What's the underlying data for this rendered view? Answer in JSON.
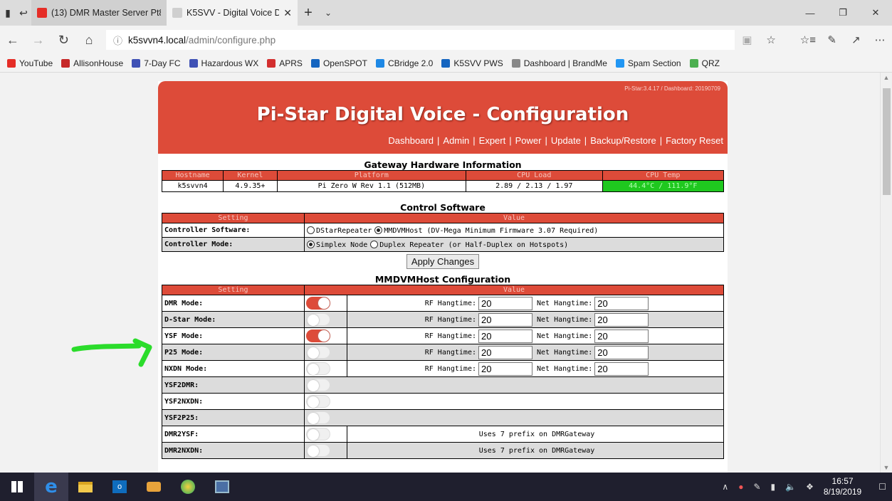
{
  "browser": {
    "tabs": [
      {
        "title": "(13) DMR Master Server Pt8",
        "active": false,
        "favicon_color": "#e52d27"
      },
      {
        "title": "K5SVV - Digital Voice D",
        "active": true,
        "favicon_color": "#cfcfcf"
      }
    ],
    "url": {
      "host": "k5svvn4.local",
      "path": "/admin/configure.php"
    },
    "favorites": [
      {
        "label": "YouTube",
        "color": "#e52d27"
      },
      {
        "label": "AllisonHouse",
        "color": "#c62828"
      },
      {
        "label": "7-Day FC",
        "color": "#3f51b5"
      },
      {
        "label": "Hazardous WX",
        "color": "#3f51b5"
      },
      {
        "label": "APRS",
        "color": "#d32f2f"
      },
      {
        "label": "OpenSPOT",
        "color": "#1565c0"
      },
      {
        "label": "CBridge 2.0",
        "color": "#1e88e5"
      },
      {
        "label": "K5SVV PWS",
        "color": "#1565c0"
      },
      {
        "label": "Dashboard | BrandMe",
        "color": "#888888"
      },
      {
        "label": "Spam Section",
        "color": "#2196f3"
      },
      {
        "label": "QRZ",
        "color": "#4caf50"
      }
    ]
  },
  "header": {
    "version": "Pi-Star:3.4.17 / Dashboard: 20190709",
    "title": "Pi-Star Digital Voice - Configuration",
    "nav": [
      "Dashboard",
      "Admin",
      "Expert",
      "Power",
      "Update",
      "Backup/Restore",
      "Factory Reset"
    ]
  },
  "gateway": {
    "title": "Gateway Hardware Information",
    "headers": [
      "Hostname",
      "Kernel",
      "Platform",
      "CPU Load",
      "CPU Temp"
    ],
    "values": [
      "k5svvn4",
      "4.9.35+",
      "Pi Zero W Rev 1.1 (512MB)",
      "2.89 / 2.13 / 1.97",
      "44.4°C / 111.9°F"
    ]
  },
  "control": {
    "title": "Control Software",
    "headers": [
      "Setting",
      "Value"
    ],
    "rows": [
      {
        "label": "Controller Software:",
        "options": [
          {
            "text": "DStarRepeater",
            "selected": false
          },
          {
            "text": "MMDVMHost (DV-Mega Minimum Firmware 3.07 Required)",
            "selected": true
          }
        ]
      },
      {
        "label": "Controller Mode:",
        "options": [
          {
            "text": "Simplex Node",
            "selected": true
          },
          {
            "text": "Duplex Repeater (or Half-Duplex on Hotspots)",
            "selected": false
          }
        ]
      }
    ],
    "apply_label": "Apply Changes"
  },
  "mmdvm": {
    "title": "MMDVMHost Configuration",
    "headers": [
      "Setting",
      "Value"
    ],
    "rf_label": "RF Hangtime:",
    "net_label": "Net Hangtime:",
    "rows": [
      {
        "label": "DMR Mode:",
        "on": true,
        "rf": "20",
        "net": "20"
      },
      {
        "label": "D-Star Mode:",
        "on": false,
        "rf": "20",
        "net": "20"
      },
      {
        "label": "YSF Mode:",
        "on": true,
        "rf": "20",
        "net": "20"
      },
      {
        "label": "P25 Mode:",
        "on": false,
        "rf": "20",
        "net": "20"
      },
      {
        "label": "NXDN Mode:",
        "on": false,
        "rf": "20",
        "net": "20"
      },
      {
        "label": "YSF2DMR:",
        "on": false
      },
      {
        "label": "YSF2NXDN:",
        "on": false
      },
      {
        "label": "YSF2P25:",
        "on": false
      },
      {
        "label": "DMR2YSF:",
        "on": false,
        "note": "Uses 7 prefix on DMRGateway"
      },
      {
        "label": "DMR2NXDN:",
        "on": false,
        "note": "Uses 7 prefix on DMRGateway"
      }
    ]
  },
  "taskbar": {
    "time": "16:57",
    "date": "8/19/2019"
  },
  "colors": {
    "accent": "#dd4b39",
    "temp_ok": "#1fc81f",
    "annotation": "#2bdc2b"
  }
}
